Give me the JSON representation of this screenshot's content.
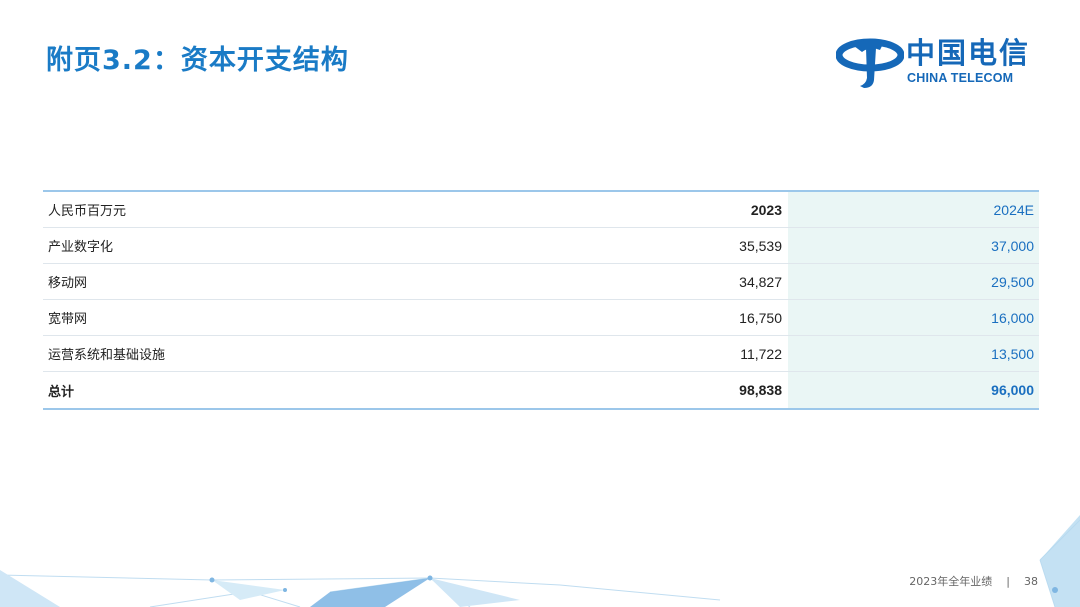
{
  "title": "附页3.2：资本开支结构",
  "logo": {
    "cn": "中国电信",
    "en": "CHINA TELECOM",
    "color": "#1568b8"
  },
  "table": {
    "header": {
      "label": "人民币百万元",
      "col_2023": "2023",
      "col_2024": "2024E"
    },
    "rows": [
      {
        "label": "产业数字化",
        "v2023": "35,539",
        "v2024": "37,000"
      },
      {
        "label": "移动网",
        "v2023": "34,827",
        "v2024": "29,500"
      },
      {
        "label": "宽带网",
        "v2023": "16,750",
        "v2024": "16,000"
      },
      {
        "label": "运营系统和基础设施",
        "v2023": "11,722",
        "v2024": "13,500"
      }
    ],
    "total": {
      "label": "总计",
      "v2023": "98,838",
      "v2024": "96,000"
    }
  },
  "footer": {
    "text": "2023年全年业绩",
    "separator": "|",
    "page": "38"
  },
  "colors": {
    "title": "#1a7bc6",
    "accent_blue": "#1a6fc0",
    "estimate_bg": "#eaf6f5",
    "rule": "#9cc7ea"
  }
}
